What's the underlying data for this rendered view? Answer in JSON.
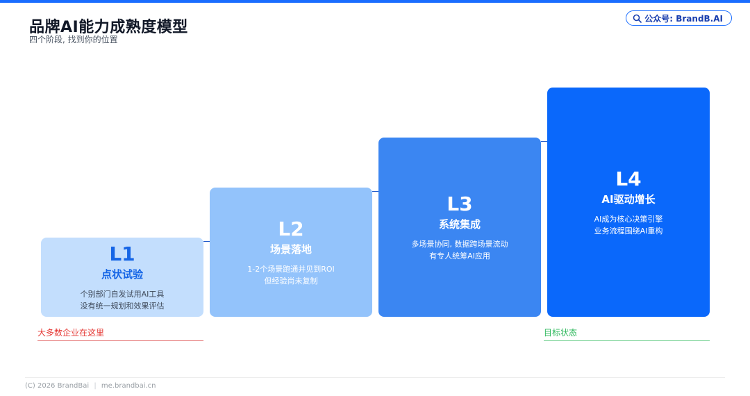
{
  "header": {
    "title": "品牌AI能力成熟度模型",
    "subtitle": "四个阶段, 找到你的位置",
    "badge": {
      "icon": "search-icon",
      "text": "公众号: BrandB.AI"
    }
  },
  "steps": [
    {
      "level": "L1",
      "name": "点状试验",
      "desc": [
        "个别部门自发试用AI工具",
        "没有统一规划和效果评估"
      ]
    },
    {
      "level": "L2",
      "name": "场景落地",
      "desc": [
        "1-2个场景跑通并见到ROI",
        "但经验尚未复制"
      ]
    },
    {
      "level": "L3",
      "name": "系统集成",
      "desc": [
        "多场景协同, 数据跨场景流动",
        "有专人统筹AI应用"
      ]
    },
    {
      "level": "L4",
      "name": "AI驱动增长",
      "desc": [
        "AI成为核心决策引擎",
        "业务流程围绕AI重构"
      ]
    }
  ],
  "markers": {
    "current": "大多数企业在这里",
    "target": "目标状态"
  },
  "footer": {
    "copyright": "(C) 2026 BrandBai",
    "site": "me.brandbai.cn"
  },
  "colors": {
    "accent": "#1a6dff",
    "l1": "#c3defd",
    "l2": "#93c3fb",
    "l3": "#3b86f2",
    "l4": "#0a68fb",
    "current_marker": "#e53935",
    "target_marker": "#2eb85c"
  }
}
